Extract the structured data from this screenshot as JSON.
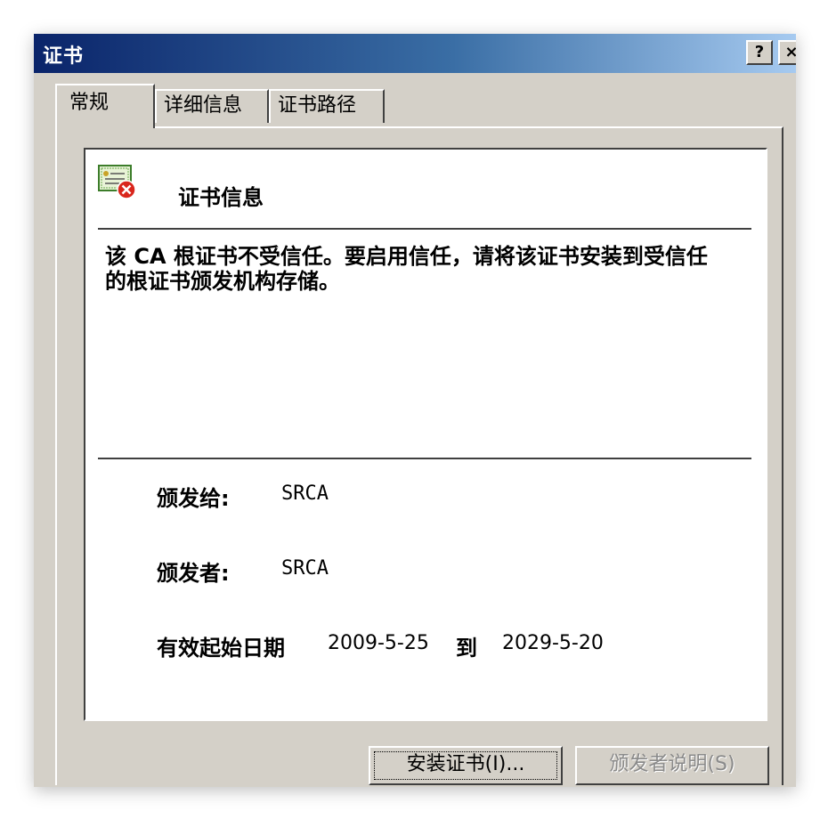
{
  "window": {
    "title": "证书",
    "help_label": "?",
    "close_label": "×"
  },
  "tabs": [
    {
      "label": "常规",
      "active": true
    },
    {
      "label": "详细信息",
      "active": false
    },
    {
      "label": "证书路径",
      "active": false
    }
  ],
  "cert_info": {
    "heading": "证书信息",
    "icon": "certificate-error-icon",
    "warning": "该 CA 根证书不受信任。要启用信任，请将该证书安装到受信任的根证书颁发机构存储。",
    "issued_to_label": "颁发给:",
    "issued_to_value": "SRCA",
    "issued_by_label": "颁发者:",
    "issued_by_value": "SRCA",
    "valid_label": "有效起始日期",
    "valid_from": "2009-5-25",
    "valid_to_word": "到",
    "valid_to": "2029-5-20"
  },
  "buttons": {
    "install": "安装证书(I)...",
    "issuer_statement": "颁发者说明(S)"
  },
  "colors": {
    "titlebar_start": "#0a246a",
    "titlebar_end": "#a6caf0",
    "dialog_face": "#d4d0c8",
    "error_red": "#d9261c"
  }
}
